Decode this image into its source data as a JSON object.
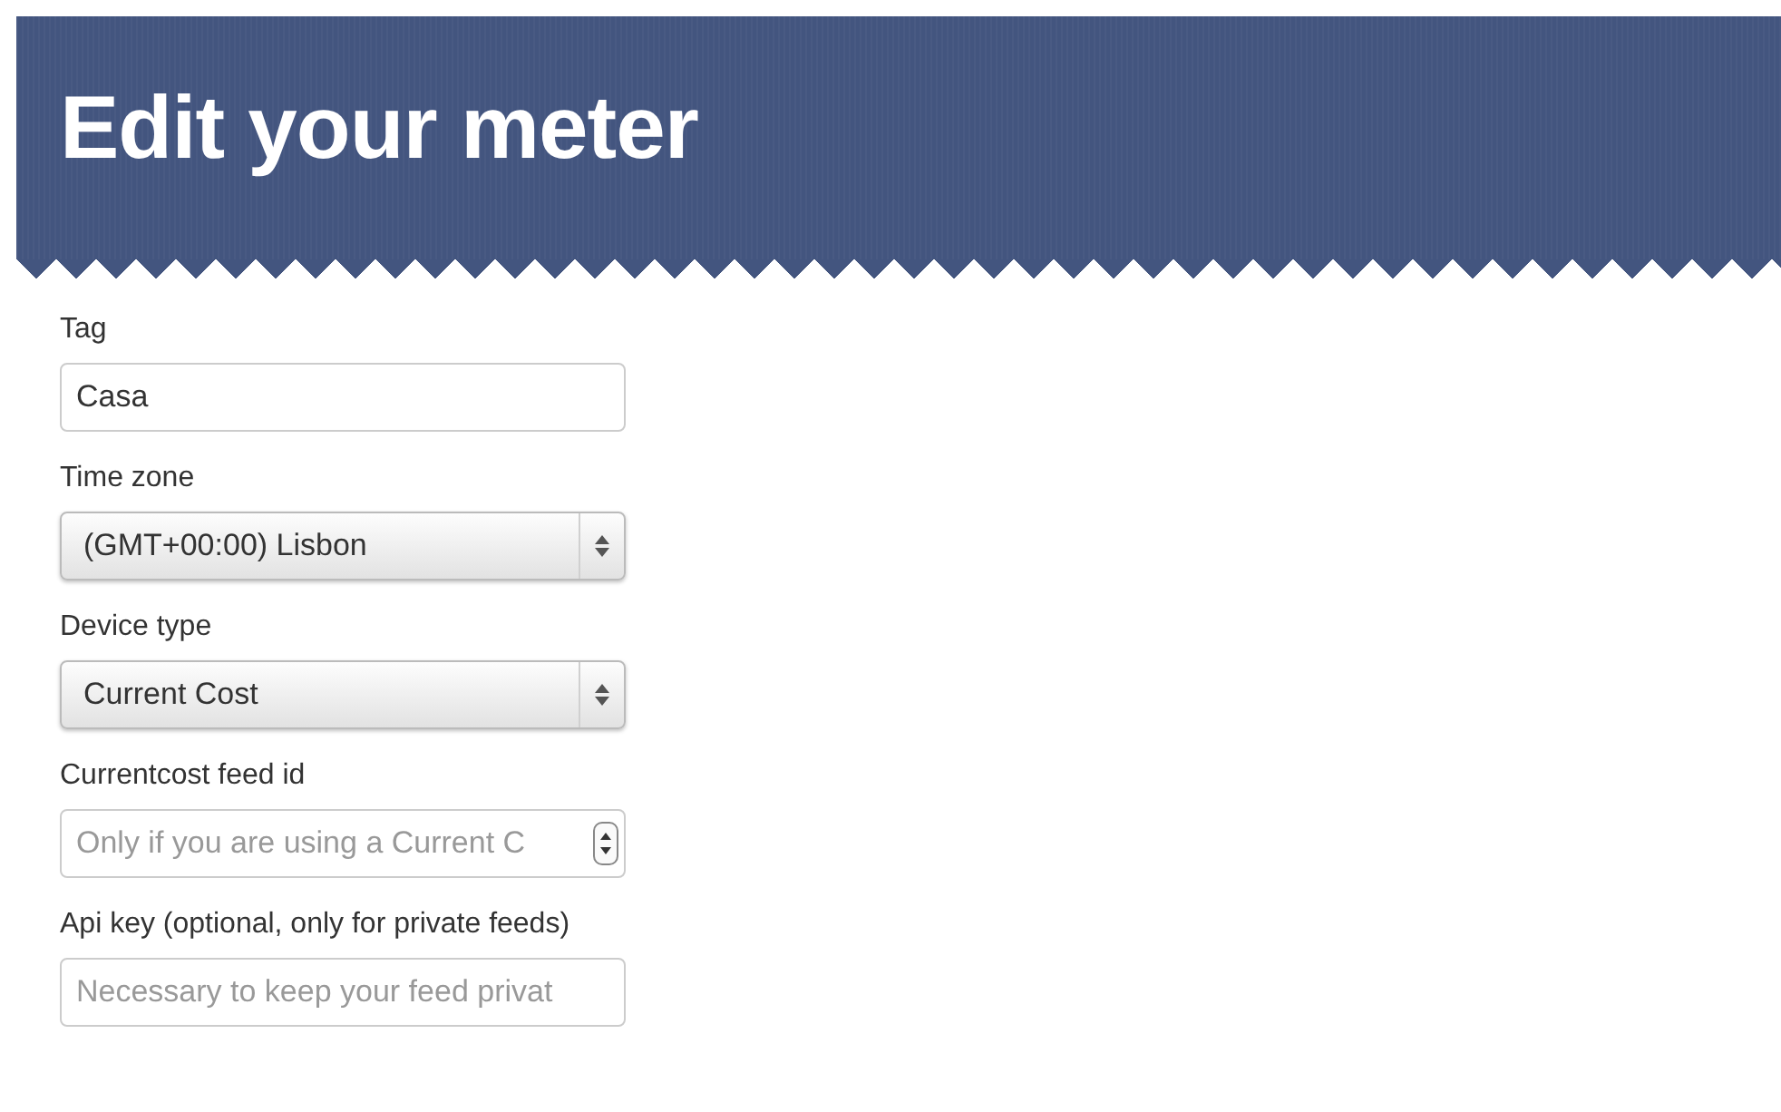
{
  "header": {
    "title": "Edit your meter"
  },
  "fields": [
    {
      "kind": "text",
      "label": "Tag",
      "value": "Casa"
    },
    {
      "kind": "select",
      "label": "Time zone",
      "value": "(GMT+00:00) Lisbon"
    },
    {
      "kind": "select",
      "label": "Device type",
      "value": "Current Cost"
    },
    {
      "kind": "number",
      "label": "Currentcost feed id",
      "placeholder": "Only if you are using a Current C"
    },
    {
      "kind": "text",
      "label": "Api key (optional, only for private feeds)",
      "placeholder": "Necessary to keep your feed privat"
    }
  ]
}
